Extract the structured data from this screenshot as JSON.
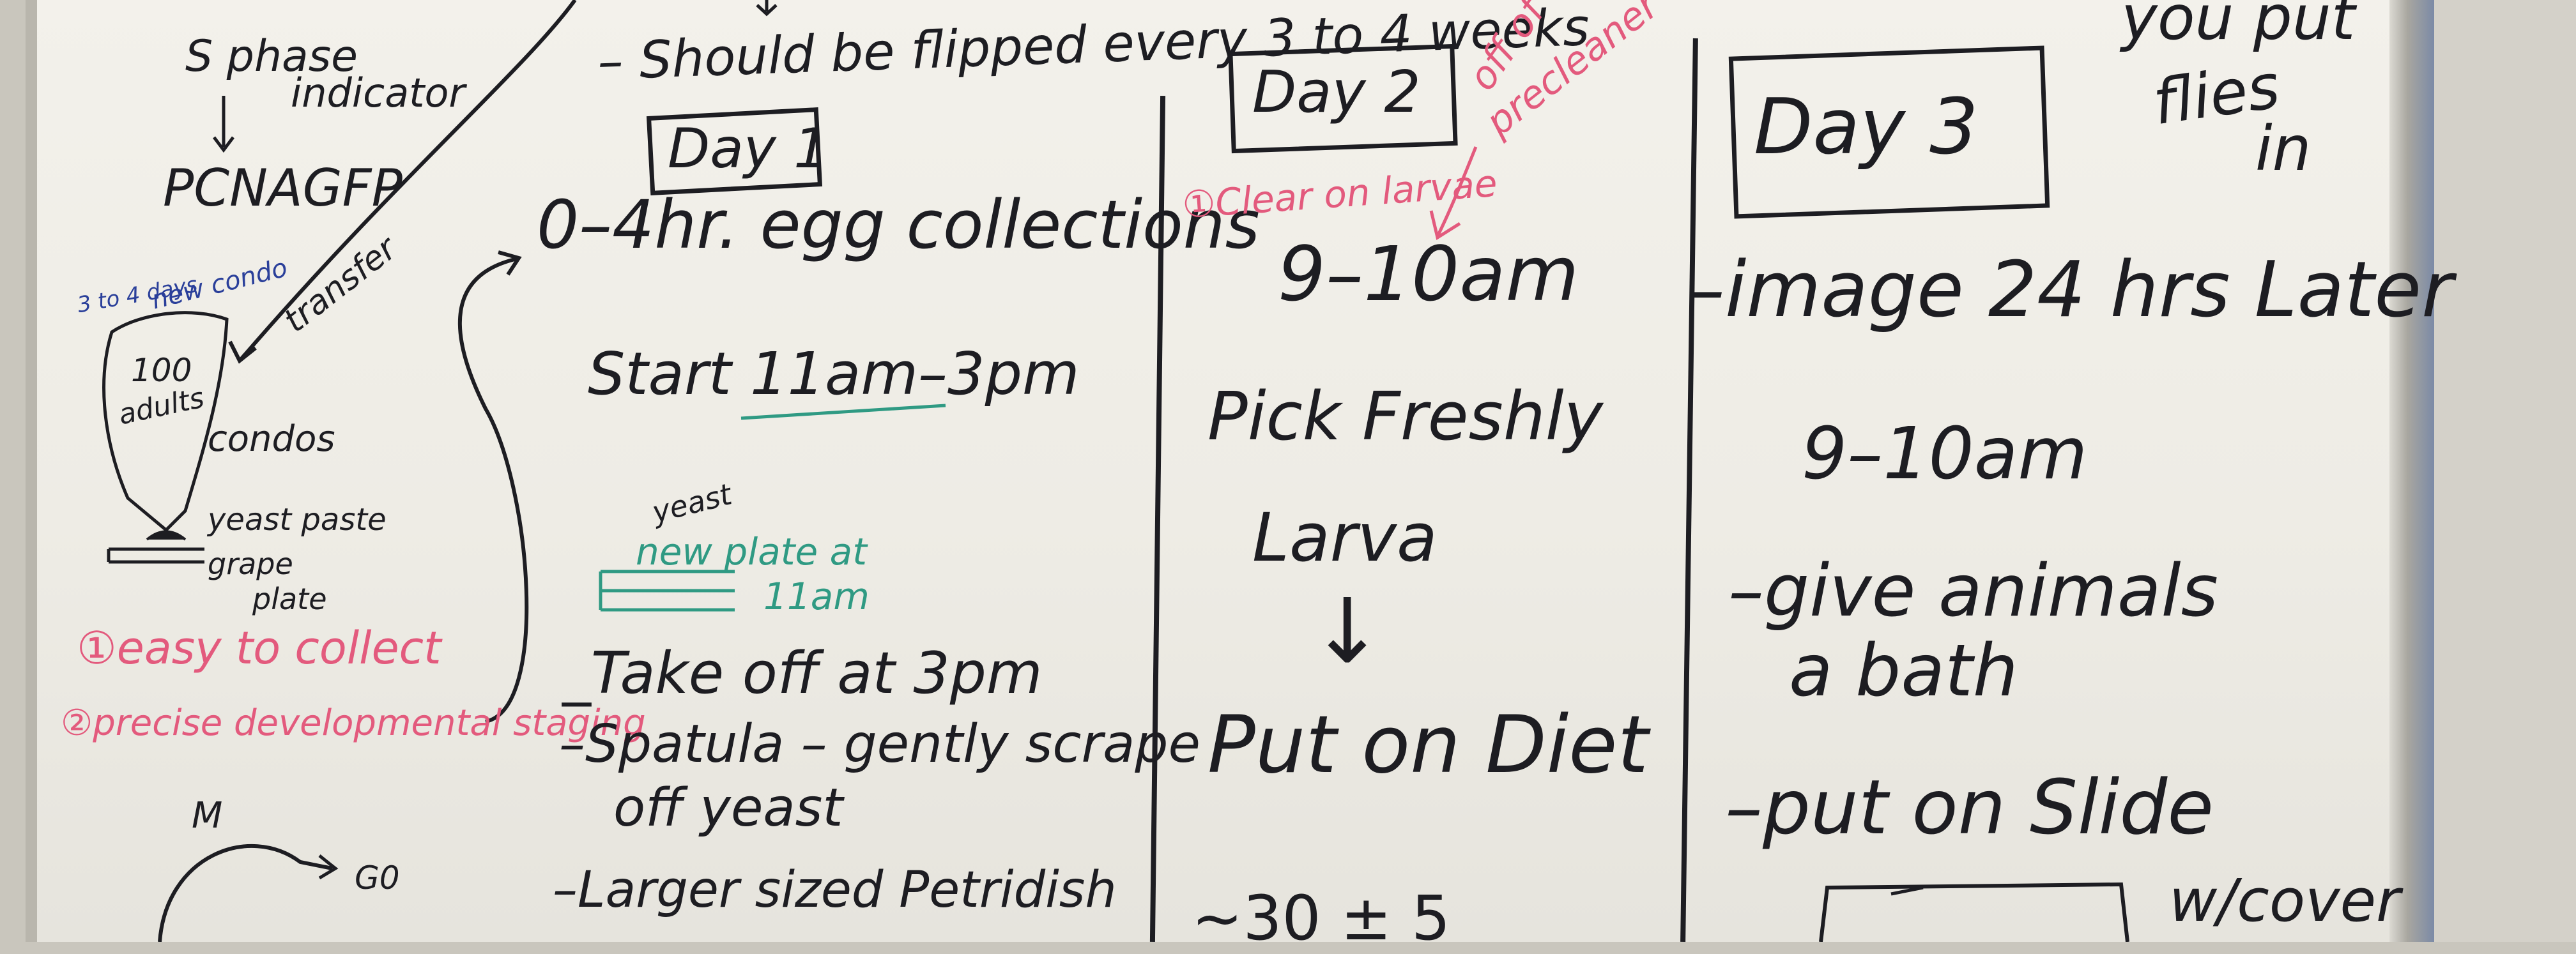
{
  "left": {
    "s_phase_line1": "S phase",
    "s_phase_line2": "indicator",
    "pcna": "PCNAGFP",
    "days_note": "3 to 4 days",
    "new_condo": "new condo",
    "transfer": "transfer",
    "adults_count": "100",
    "adults_word": "adults",
    "condos": "condos",
    "yeast_paste": "yeast paste",
    "grape": "grape",
    "plate": "plate",
    "point1": "①easy to collect",
    "point2": "②precise developmental staging",
    "cycle_m": "M",
    "cycle_g0": "G0"
  },
  "day1": {
    "flip_note": "– Should be flipped every 3 to 4 weeks",
    "title": "Day 1",
    "egg": "0–4hr. egg collections",
    "start": "Start 11am–3pm",
    "yeast": "yeast",
    "new_plate": "new plate at",
    "eleven": "11am",
    "take_off": "_Take off at 3pm",
    "spatula": "–Spatula – gently scrape",
    "off_yeast": "off yeast",
    "larger": "–Larger sized Petridish"
  },
  "day2": {
    "title": "Day 2",
    "clear": "①Clear on larvae",
    "red_note1": "off of",
    "red_note2": "precleaner",
    "time": "9–10am",
    "pick": "Pick Freshly",
    "larva": "Larva",
    "arrow": "↓",
    "put": "Put on Diet",
    "approx": "∼30 ± 5"
  },
  "day3": {
    "title": "Day 3",
    "image": "–image 24 hrs Later",
    "time": "9–10am",
    "give": "–give animals",
    "bath": "a bath",
    "put_slide": "–put on Slide",
    "coverslip": "w/cover",
    "you_put": "you put",
    "flies": "flies",
    "in": "in"
  },
  "colors": {
    "marker_black": "#1d1d22",
    "marker_pink": "#e35a7d",
    "marker_blue": "#2a3f9a",
    "marker_green": "#2f9a83"
  }
}
